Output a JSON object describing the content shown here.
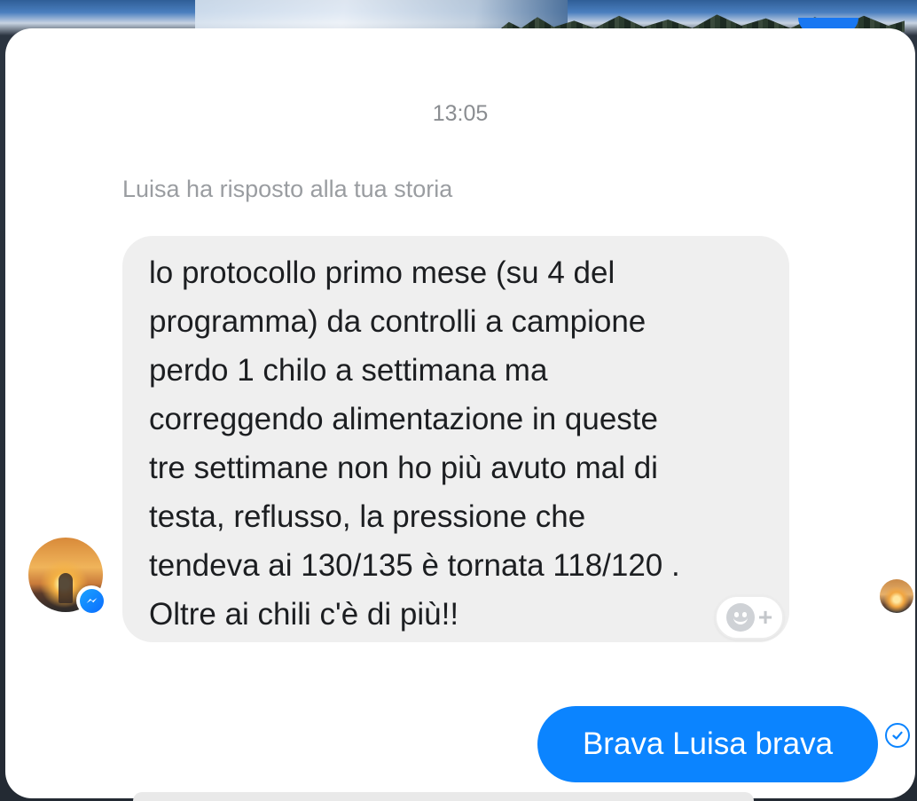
{
  "conversation": {
    "timestamp": "13:05",
    "story_reply_note": "Luisa ha risposto alla tua storia",
    "incoming_message": {
      "lines": [
        "lo protocollo primo mese (su 4 del",
        "programma) da controlli a campione",
        "perdo 1 chilo a settimana ma",
        "correggendo alimentazione in queste",
        "tre settimane non ho più avuto mal di",
        "testa, reflusso, la pressione che",
        "tendeva ai 130/135 è tornata 118/120 .",
        "Oltre ai chili c'è di più!!"
      ],
      "reaction_plus": "+"
    },
    "outgoing_message": {
      "text": "Brava Luisa brava"
    }
  },
  "icons": {
    "sender_avatar": "avatar-icon",
    "messenger_badge": "messenger-icon",
    "reaction_button": "emoji-add-icon",
    "read_receipt": "avatar-read-receipt-icon",
    "sent_status": "check-circle-icon"
  },
  "colors": {
    "outgoing_bubble": "#0b84ff",
    "incoming_bubble": "#efefef",
    "muted_text": "#8a8d91"
  }
}
